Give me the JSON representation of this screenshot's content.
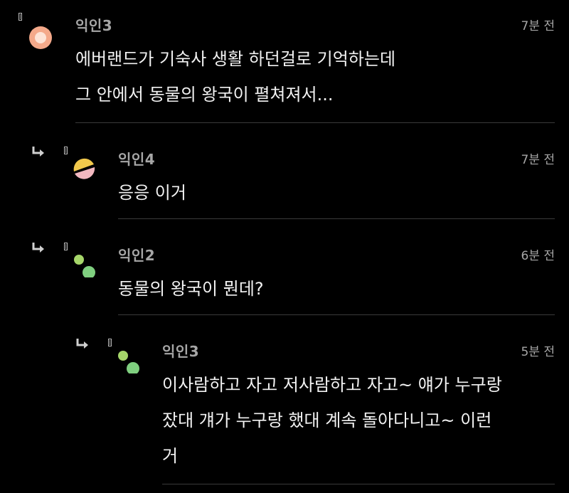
{
  "comments": [
    {
      "nickname": "익인3",
      "time": "7분 전",
      "text": "에버랜드가 기숙사 생활 하던걸로 기억하는데\n그 안에서 동물의 왕국이 펼쳐져서..."
    },
    {
      "nickname": "익인4",
      "time": "7분 전",
      "text": "응응 이거"
    },
    {
      "nickname": "익인2",
      "time": "6분 전",
      "text": "동물의 왕국이 뭔데?"
    },
    {
      "nickname": "익인3",
      "time": "5분 전",
      "text": "이사람하고 자고 저사람하고 자고~ 얘가 누구랑\n잤대 걔가 누구랑 했대 계속 돌아다니고~ 이런\n거"
    }
  ],
  "avatar_colors": {
    "c0_outer": "#f4a98a",
    "c0_inner": "#fde3d6",
    "c1_top": "#f2c94c",
    "c1_bottom": "#f2b8c0",
    "dots_small": "#a6d66a",
    "dots_large": "#7fcf7f"
  }
}
